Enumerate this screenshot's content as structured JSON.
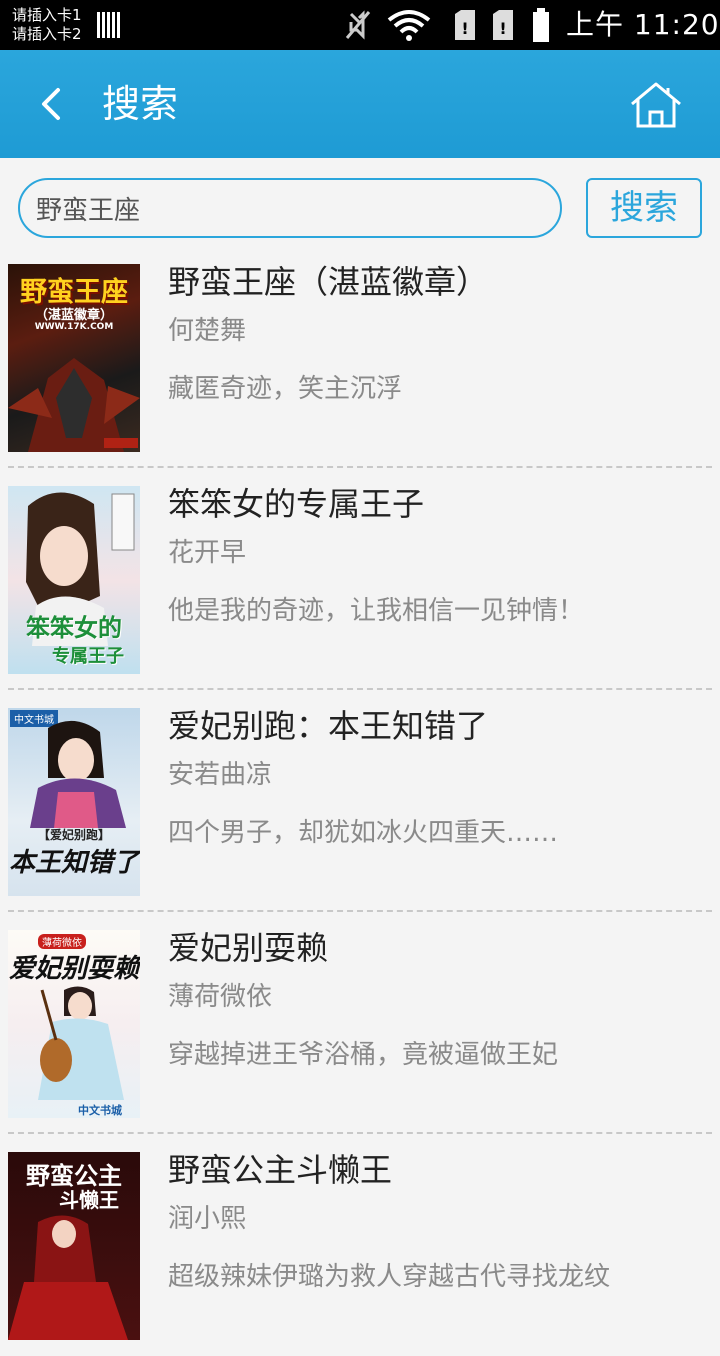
{
  "status_bar": {
    "sim1": "请插入卡1",
    "sim2": "请插入卡2",
    "clock": "上午 11:20",
    "icons": [
      "signal-icon",
      "mute-icon",
      "wifi-icon",
      "sim1-icon",
      "sim2-icon",
      "battery-icon"
    ]
  },
  "header": {
    "title": "搜索",
    "back_icon": "back-icon",
    "home_icon": "home-icon"
  },
  "search": {
    "value": "野蛮王座",
    "button_label": "搜索"
  },
  "results": [
    {
      "title": "野蛮王座（湛蓝徽章）",
      "author": "何楚舞",
      "desc": "藏匿奇迹，笑主沉浮",
      "cover_text": "野蛮王座",
      "cover_sub": "（湛蓝徽章）",
      "cover_site": "WWW.17K.COM"
    },
    {
      "title": "笨笨女的专属王子",
      "author": "花开早",
      "desc": "他是我的奇迹，让我相信一见钟情！",
      "cover_text": "笨笨女的",
      "cover_sub": "专属王子"
    },
    {
      "title": "爱妃别跑：本王知错了",
      "author": "安若曲凉",
      "desc": "四个男子，却犹如冰火四重天……",
      "cover_text": "本王知错了",
      "cover_sub": "【爱妃别跑】",
      "cover_brand": "中文书城"
    },
    {
      "title": "爱妃别耍赖",
      "author": "薄荷微依",
      "desc": "穿越掉进王爷浴桶，竟被逼做王妃",
      "cover_text": "爱妃别耍赖",
      "cover_sub": "薄荷微依",
      "cover_brand": "中文书城"
    },
    {
      "title": "野蛮公主斗懒王",
      "author": "润小熙",
      "desc": "超级辣妹伊璐为救人穿越古代寻找龙纹",
      "cover_text": "野蛮公主",
      "cover_sub": "斗懒王"
    }
  ],
  "colors": {
    "accent": "#2ba6dc",
    "background": "#f4f4f4",
    "statusbar": "#000000"
  }
}
